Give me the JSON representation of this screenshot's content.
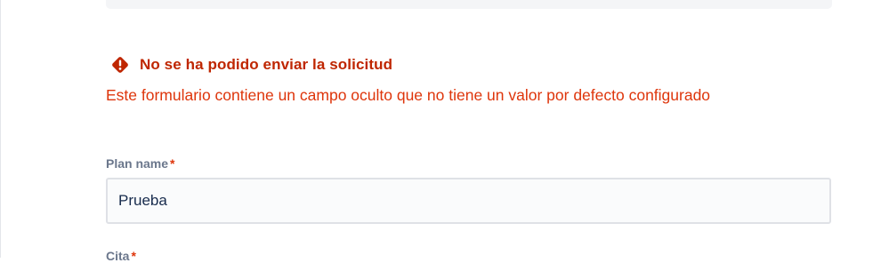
{
  "error": {
    "title": "No se ha podido enviar la solicitud",
    "message": "Este formulario contiene un campo oculto que no tiene un valor por defecto configurado",
    "icon": "error-diamond-icon",
    "color": "#de350b"
  },
  "form": {
    "plan_name": {
      "label": "Plan name",
      "required_marker": "*",
      "value": "Prueba"
    },
    "next_field": {
      "label": "Cita",
      "required_marker": "*"
    }
  }
}
